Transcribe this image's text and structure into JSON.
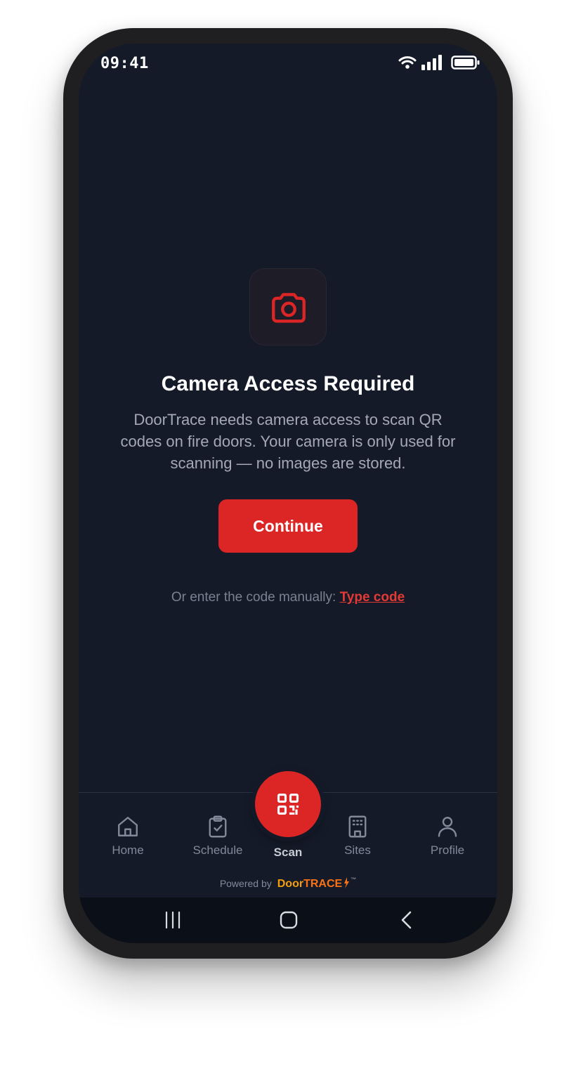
{
  "status_bar": {
    "time": "09:41"
  },
  "permission": {
    "icon": "camera-icon",
    "title": "Camera Access Required",
    "description": "DoorTrace needs camera access to scan QR codes on fire doors. Your camera is only used for scanning — no images are stored.",
    "continue_label": "Continue",
    "manual_prefix": "Or enter the code manually:",
    "manual_link": "Type code"
  },
  "bottom_nav": {
    "items": [
      {
        "label": "Home",
        "icon": "home-icon"
      },
      {
        "label": "Schedule",
        "icon": "clipboard-check-icon"
      },
      {
        "label": "Scan",
        "icon": "qr-code-icon"
      },
      {
        "label": "Sites",
        "icon": "building-icon"
      },
      {
        "label": "Profile",
        "icon": "user-icon"
      }
    ]
  },
  "footer": {
    "powered_by": "Powered by",
    "brand_primary": "Door",
    "brand_secondary": "TRACE",
    "trademark": "™"
  },
  "colors": {
    "accent": "#dc2626",
    "background": "#141a28",
    "muted_text": "#838998"
  }
}
